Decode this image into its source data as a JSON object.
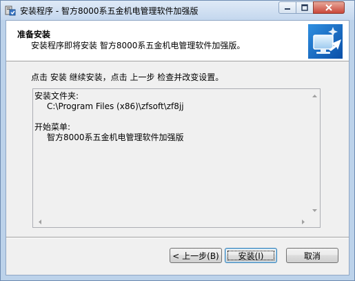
{
  "window": {
    "title": "安装程序 - 智方8000系五金机电管理软件加强版"
  },
  "header": {
    "title": "准备安装",
    "subtitle": "安装程序即将安装 智方8000系五金机电管理软件加强版。"
  },
  "instruction": "点击 安装 继续安装，点击 上一步 检查并改变设置。",
  "memo": {
    "lines": [
      {
        "text": "安装文件夹:",
        "indent": false
      },
      {
        "text": "C:\\Program Files (x86)\\zfsoft\\zf8jj",
        "indent": true
      },
      {
        "text": "",
        "indent": false
      },
      {
        "text": "开始菜单:",
        "indent": false
      },
      {
        "text": "智方8000系五金机电管理软件加强版",
        "indent": true
      }
    ]
  },
  "buttons": {
    "back": "< 上一步(B)",
    "install": "安装(I)",
    "cancel": "取消"
  },
  "icons": {
    "window_controls": [
      "minimize-icon",
      "maximize-icon",
      "close-icon"
    ],
    "app": "installer-icon",
    "header_image": "computer-install-icon"
  },
  "colors": {
    "titlebar": "#c4d7ee",
    "close_button": "#c9473a",
    "dialog_bg": "#f0f0f0",
    "header_bg": "#ffffff"
  }
}
